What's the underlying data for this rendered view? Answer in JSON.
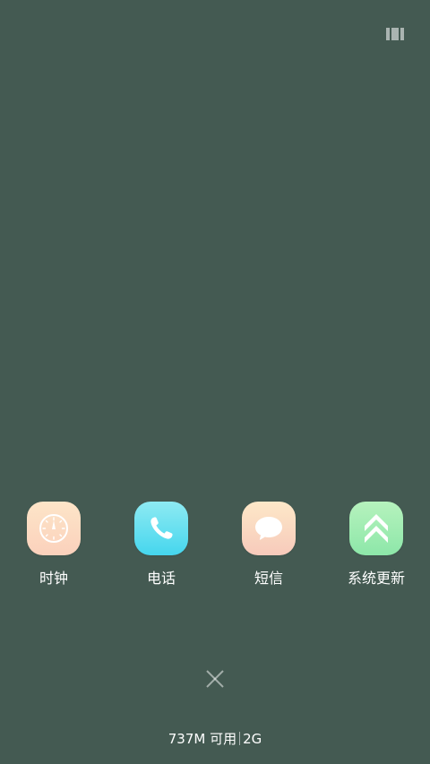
{
  "apps": [
    {
      "label": "时钟",
      "icon": "clock-icon"
    },
    {
      "label": "电话",
      "icon": "phone-icon"
    },
    {
      "label": "短信",
      "icon": "message-bubble-icon"
    },
    {
      "label": "系统更新",
      "icon": "double-chevron-up-icon"
    }
  ],
  "memory": {
    "available": "737M 可用",
    "total": "2G"
  },
  "colors": {
    "background": "#445a52",
    "clock_icon": "#fcdcc3",
    "phone_icon": "#5fdcef",
    "sms_icon": "#fad6c0",
    "update_icon": "#9cebb0"
  },
  "icons": {
    "top_right": "multi-window-toggle-icon",
    "close": "close-icon"
  }
}
